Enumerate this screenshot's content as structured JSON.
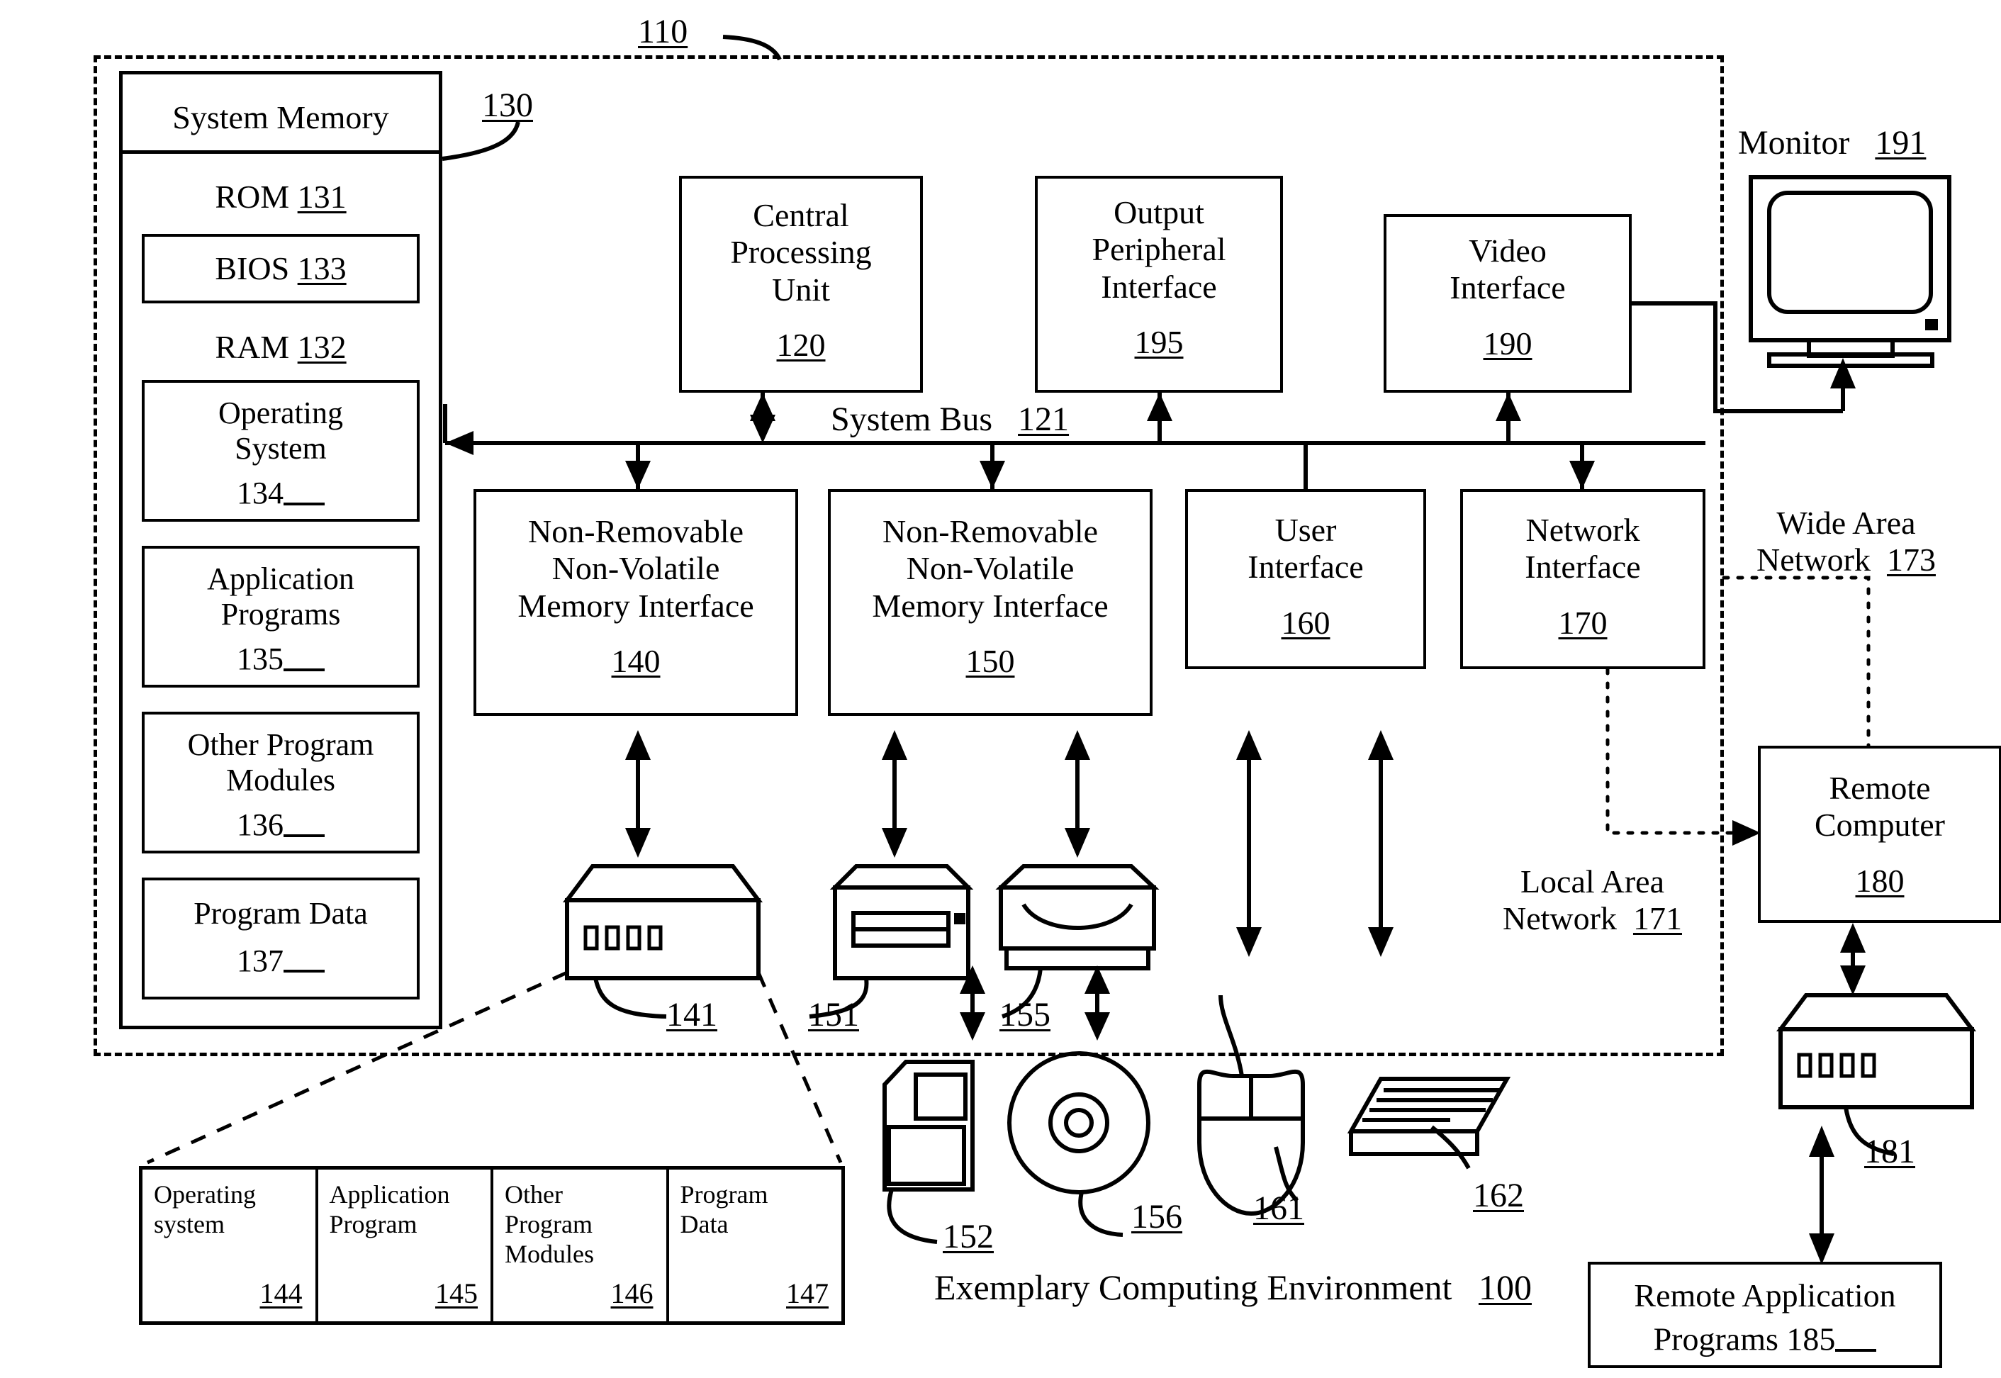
{
  "figure": {
    "caption": "Exemplary Computing Environment",
    "caption_ref": "100",
    "computer_ref": "110"
  },
  "system_memory": {
    "title": "System Memory",
    "title_ref": "130",
    "rom": {
      "label": "ROM",
      "ref": "131"
    },
    "bios": {
      "label": "BIOS",
      "ref": "133"
    },
    "ram": {
      "label": "RAM",
      "ref": "132"
    },
    "blocks": [
      {
        "name": "operating-system",
        "line1": "Operating",
        "line2": "System",
        "ref": "134"
      },
      {
        "name": "application-programs",
        "line1": "Application",
        "line2": "Programs",
        "ref": "135"
      },
      {
        "name": "other-program-modules",
        "line1": "Other Program",
        "line2": "Modules",
        "ref": "136"
      },
      {
        "name": "program-data",
        "line1": "Program Data",
        "line2": "",
        "ref": "137"
      }
    ]
  },
  "bus": {
    "label": "System Bus",
    "ref": "121"
  },
  "top_units": [
    {
      "name": "central-processing-unit",
      "lines": [
        "Central",
        "Processing",
        "Unit"
      ],
      "ref": "120"
    },
    {
      "name": "output-peripheral-interface",
      "lines": [
        "Output",
        "Peripheral",
        "Interface"
      ],
      "ref": "195"
    },
    {
      "name": "video-interface",
      "lines": [
        "Video",
        "Interface"
      ],
      "ref": "190"
    }
  ],
  "interface_units": [
    {
      "name": "non-removable-nonvolatile-memory-interface",
      "lines": [
        "Non-Removable",
        "Non-Volatile",
        "Memory Interface"
      ],
      "ref": "140"
    },
    {
      "name": "removable-nonvolatile-memory-interface",
      "lines": [
        "Non-Removable",
        "Non-Volatile",
        "Memory Interface"
      ],
      "ref": "150"
    },
    {
      "name": "user-interface",
      "lines": [
        "User",
        "Interface"
      ],
      "ref": "160"
    },
    {
      "name": "network-interface",
      "lines": [
        "Network",
        "Interface"
      ],
      "ref": "170"
    }
  ],
  "monitor": {
    "label": "Monitor",
    "ref": "191"
  },
  "networks": {
    "wan": {
      "line1": "Wide Area",
      "line2": "Network",
      "ref": "173"
    },
    "lan": {
      "line1": "Local Area",
      "line2": "Network",
      "ref": "171"
    }
  },
  "remote": {
    "computer": {
      "line1": "Remote",
      "line2": "Computer",
      "ref": "180"
    },
    "modem_ref": "181",
    "apps": {
      "line1": "Remote Application",
      "line2": "Programs",
      "ref": "185"
    }
  },
  "device_refs": {
    "hard_drive": "141",
    "floppy_drive": "151",
    "optical_drive": "155",
    "floppy_disk": "152",
    "optical_disc": "156",
    "mouse": "161",
    "keyboard": "162"
  },
  "storage_table": {
    "cells": [
      {
        "name": "operating-system-cell",
        "line1": "Operating",
        "line2": "system",
        "line3": "",
        "ref": "144"
      },
      {
        "name": "application-program-cell",
        "line1": "Application",
        "line2": "Program",
        "line3": "",
        "ref": "145"
      },
      {
        "name": "other-program-modules-cell",
        "line1": "Other",
        "line2": "Program",
        "line3": "Modules",
        "ref": "146"
      },
      {
        "name": "program-data-cell",
        "line1": "Program",
        "line2": "Data",
        "line3": "",
        "ref": "147"
      }
    ]
  }
}
